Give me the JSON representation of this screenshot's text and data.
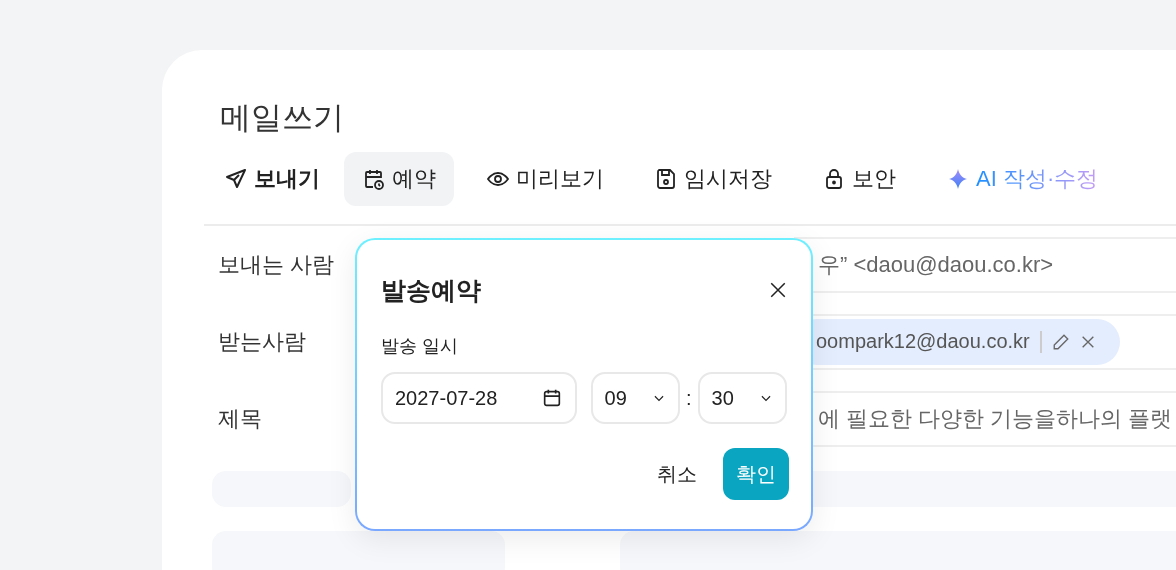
{
  "window": {
    "title": "메일쓰기"
  },
  "toolbar": [
    {
      "label": "보내기",
      "kind": "send",
      "selected": false
    },
    {
      "label": "예약",
      "kind": "schedule",
      "selected": true
    },
    {
      "label": "미리보기",
      "kind": "preview",
      "selected": false
    },
    {
      "label": "임시저장",
      "kind": "save",
      "selected": false
    },
    {
      "label": "보안",
      "kind": "lock",
      "selected": false
    },
    {
      "label": "AI 작성·수정",
      "kind": "ai",
      "selected": false
    }
  ],
  "form": {
    "sender": {
      "label": "보내는 사람",
      "value": "우” <daou@daou.co.kr>"
    },
    "recipient": {
      "label": "받는사람",
      "chip": "oompark12@daou.co.kr"
    },
    "subject": {
      "label": "제목",
      "value": "에 필요한 다양한 기능을하나의 플랫"
    }
  },
  "dialog": {
    "title": "발송예약",
    "field_label": "발송 일시",
    "date": "2027-07-28",
    "hour": "09",
    "separator": ":",
    "minute": "30",
    "cancel": "취소",
    "confirm": "확인"
  }
}
